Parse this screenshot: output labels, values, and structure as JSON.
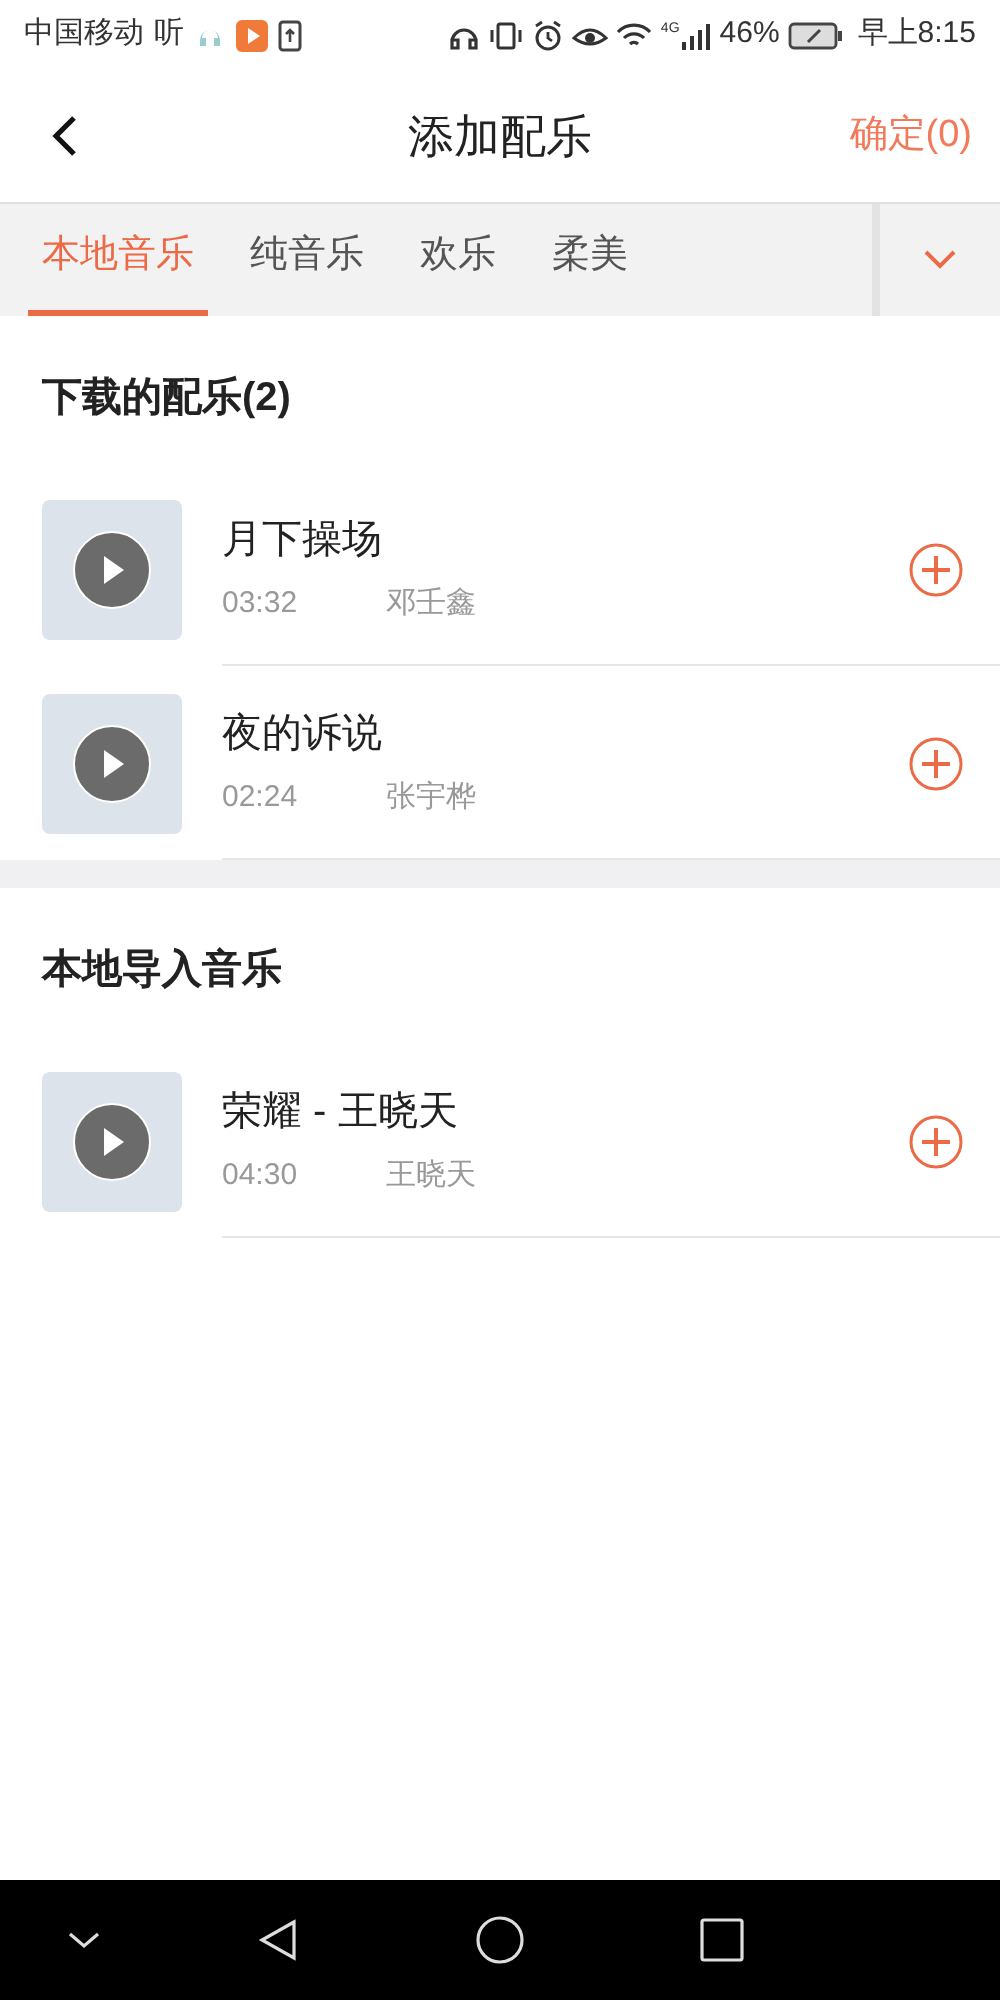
{
  "status_bar": {
    "carrier": "中国移动",
    "app_label": "听",
    "network": "4G",
    "battery": "46%",
    "time": "早上8:15"
  },
  "header": {
    "title": "添加配乐",
    "confirm": "确定(0)"
  },
  "tabs": [
    {
      "label": "本地音乐",
      "selected": true
    },
    {
      "label": "纯音乐",
      "selected": false
    },
    {
      "label": "欢乐",
      "selected": false
    },
    {
      "label": "柔美",
      "selected": false
    }
  ],
  "sections": [
    {
      "title": "下载的配乐(2)",
      "tracks": [
        {
          "title": "月下操场",
          "duration": "03:32",
          "artist": "邓壬鑫"
        },
        {
          "title": "夜的诉说",
          "duration": "02:24",
          "artist": "张宇桦"
        }
      ]
    },
    {
      "title": "本地导入音乐",
      "tracks": [
        {
          "title": "荣耀 - 王晓天",
          "duration": "04:30",
          "artist": "王晓天"
        }
      ]
    }
  ]
}
